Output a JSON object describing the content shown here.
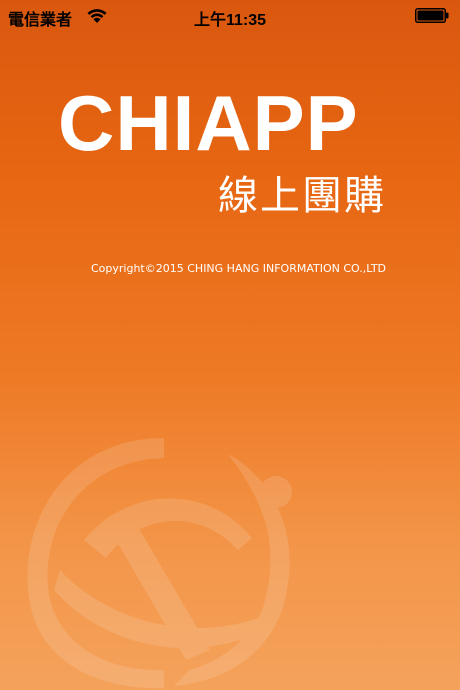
{
  "status_bar": {
    "carrier": "電信業者",
    "time": "上午11:35"
  },
  "splash": {
    "title": "CHIAPP",
    "subtitle": "線上團購",
    "copyright": "Copyright©2015 CHING HANG INFORMATION CO.,LTD"
  },
  "colors": {
    "background_top": "#d9580f",
    "background_bottom": "#f4a25b",
    "text": "#ffffff"
  },
  "icons": {
    "wifi": "wifi-icon",
    "battery": "battery-icon",
    "logo": "chiapp-globe-logo"
  }
}
